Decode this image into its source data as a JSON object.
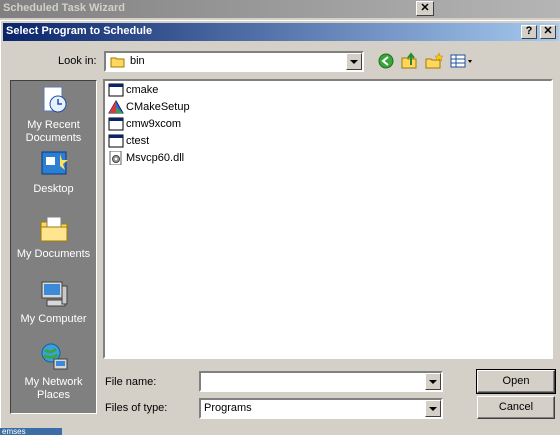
{
  "background_window": {
    "title": "Scheduled Task Wizard",
    "close_glyph": "✕"
  },
  "dialog": {
    "title": "Select Program to Schedule",
    "help_glyph": "?",
    "close_glyph": "✕"
  },
  "look_in": {
    "label": "Look in:",
    "value": "bin"
  },
  "toolbar": {
    "icons": [
      "back-icon",
      "up-folder-icon",
      "new-folder-icon",
      "views-menu-icon"
    ]
  },
  "places": [
    {
      "label": "My Recent Documents",
      "icon": "recent-documents-icon"
    },
    {
      "label": "Desktop",
      "icon": "desktop-icon"
    },
    {
      "label": "My Documents",
      "icon": "my-documents-icon"
    },
    {
      "label": "My Computer",
      "icon": "my-computer-icon"
    },
    {
      "label": "My Network Places",
      "icon": "network-places-icon"
    }
  ],
  "files": [
    {
      "name": "cmake",
      "icon": "application-icon"
    },
    {
      "name": "CMakeSetup",
      "icon": "cmake-setup-icon"
    },
    {
      "name": "cmw9xcom",
      "icon": "application-icon"
    },
    {
      "name": "ctest",
      "icon": "application-icon"
    },
    {
      "name": "Msvcp60.dll",
      "icon": "dll-file-icon"
    }
  ],
  "file_name": {
    "label": "File name:",
    "value": ""
  },
  "files_of_type": {
    "label": "Files of type:",
    "value": "Programs"
  },
  "buttons": {
    "open": "Open",
    "cancel": "Cancel"
  },
  "taskbar_fragment": "emses"
}
